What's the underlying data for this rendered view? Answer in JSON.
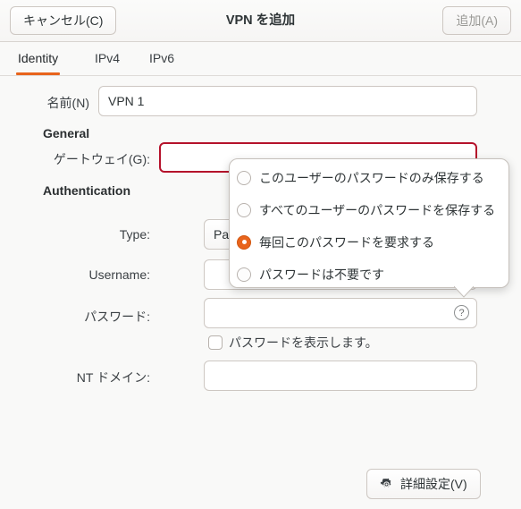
{
  "header": {
    "title": "VPN を追加",
    "cancel_label": "キャンセル(C)",
    "add_label": "追加(A)"
  },
  "tabs": [
    {
      "label": "Identity",
      "active": true
    },
    {
      "label": "IPv4",
      "active": false
    },
    {
      "label": "IPv6",
      "active": false
    }
  ],
  "form": {
    "name_label": "名前(N)",
    "name_value": "VPN 1",
    "general_heading": "General",
    "gateway_label": "ゲートウェイ(G):",
    "gateway_value": "",
    "authentication_heading": "Authentication",
    "type_label": "Type:",
    "type_value": "Pa",
    "username_label": "Username:",
    "username_value": "",
    "password_label": "パスワード:",
    "password_value": "",
    "help_icon_glyph": "?",
    "show_password_label": "パスワードを表示します。",
    "show_password_checked": false,
    "nt_domain_label": "NT ドメイン:",
    "nt_domain_value": ""
  },
  "advanced_button": {
    "label": "詳細設定(V)",
    "icon": "gear-icon"
  },
  "password_storage_popover": {
    "visible": true,
    "options": [
      {
        "label": "このユーザーのパスワードのみ保存する",
        "selected": false
      },
      {
        "label": "すべてのユーザーのパスワードを保存する",
        "selected": false
      },
      {
        "label": "毎回このパスワードを要求する",
        "selected": true
      },
      {
        "label": "パスワードは不要です",
        "selected": false
      }
    ]
  },
  "colors": {
    "accent": "#e8641c",
    "error_border": "#b5122b",
    "background": "#f9f9f8",
    "text": "#2e3436"
  }
}
